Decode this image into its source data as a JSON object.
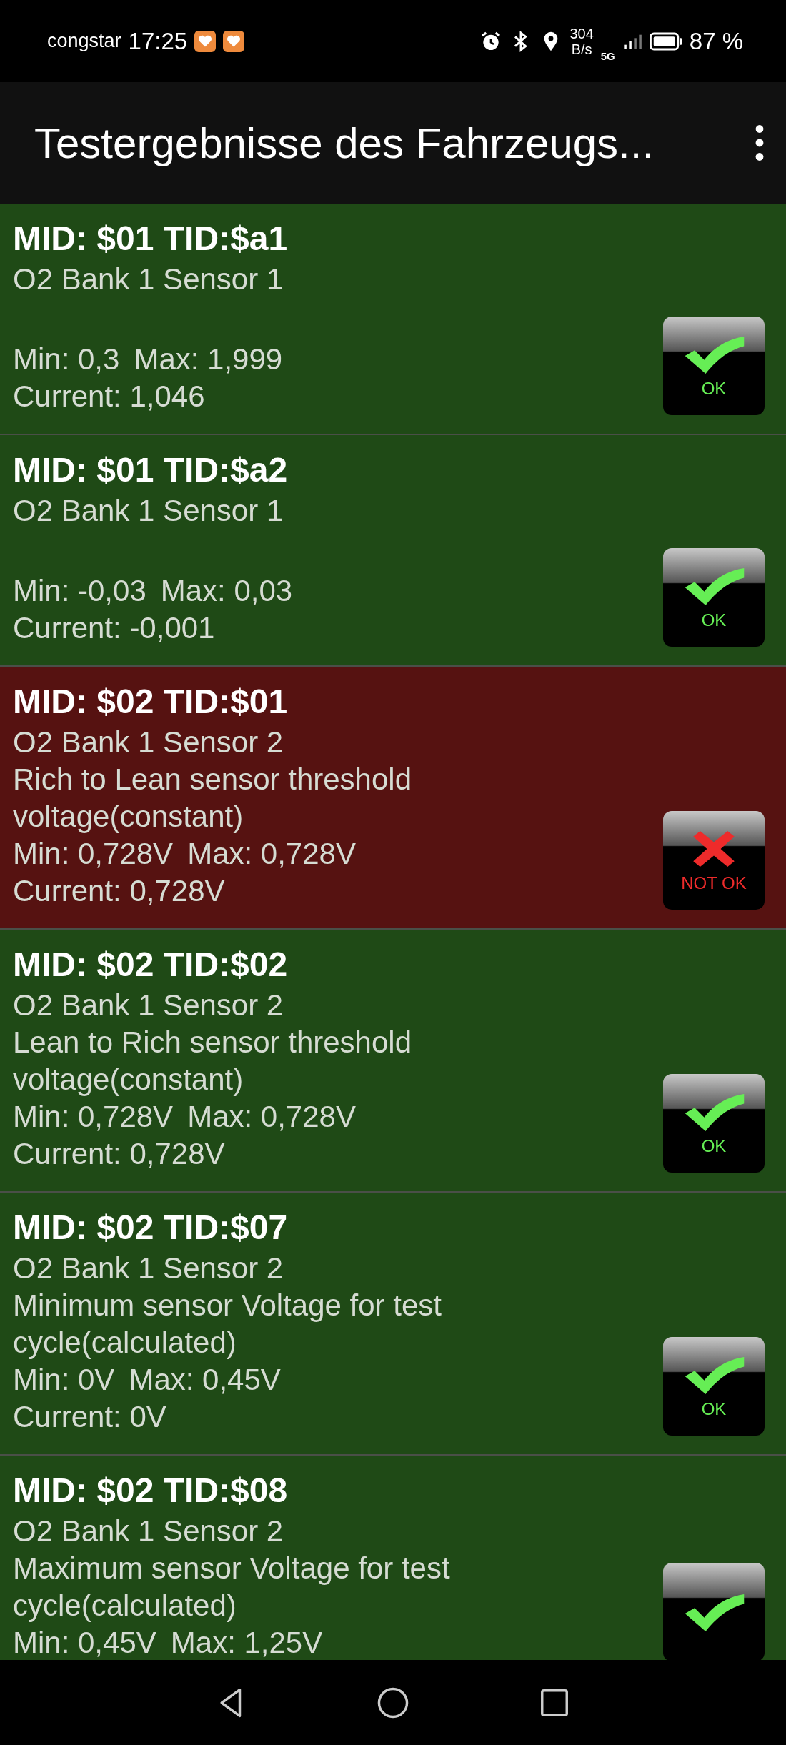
{
  "status_bar": {
    "carrier": "congstar",
    "time": "17:25",
    "speed_value": "304",
    "speed_unit": "B/s",
    "network": "5G",
    "battery": "87 %"
  },
  "app_bar": {
    "title": "Testergebnisse des Fahrzeugs..."
  },
  "results": [
    {
      "heading": "MID: $01 TID:$a1",
      "sensor": "O2 Bank 1 Sensor 1",
      "min": "Min: 0,3",
      "max": "Max: 1,999",
      "current": "Current: 1,046",
      "passed": true,
      "badge": "OK"
    },
    {
      "heading": "MID: $01 TID:$a2",
      "sensor": "O2 Bank 1 Sensor 1",
      "min": "Min: -0,03",
      "max": "Max: 0,03",
      "current": "Current: -0,001",
      "passed": true,
      "badge": "OK"
    },
    {
      "heading": "MID: $02 TID:$01",
      "sensor": "O2 Bank 1 Sensor 2",
      "description": "Rich to Lean sensor threshold voltage(constant)",
      "min": "Min: 0,728V",
      "max": "Max: 0,728V",
      "current": "Current: 0,728V",
      "passed": false,
      "badge": "NOT OK"
    },
    {
      "heading": "MID: $02 TID:$02",
      "sensor": "O2 Bank 1 Sensor 2",
      "description": "Lean to Rich sensor threshold voltage(constant)",
      "min": "Min: 0,728V",
      "max": "Max: 0,728V",
      "current": "Current: 0,728V",
      "passed": true,
      "badge": "OK"
    },
    {
      "heading": "MID: $02 TID:$07",
      "sensor": "O2 Bank 1 Sensor 2",
      "description": "Minimum sensor Voltage for test cycle(calculated)",
      "min": "Min: 0V",
      "max": "Max: 0,45V",
      "current": "Current: 0V",
      "passed": true,
      "badge": "OK"
    },
    {
      "heading": "MID: $02 TID:$08",
      "sensor": "O2 Bank 1 Sensor 2",
      "description": "Maximum sensor Voltage for test cycle(calculated)",
      "min": "Min: 0,45V",
      "max": "Max: 1,25V",
      "passed": true
    }
  ]
}
